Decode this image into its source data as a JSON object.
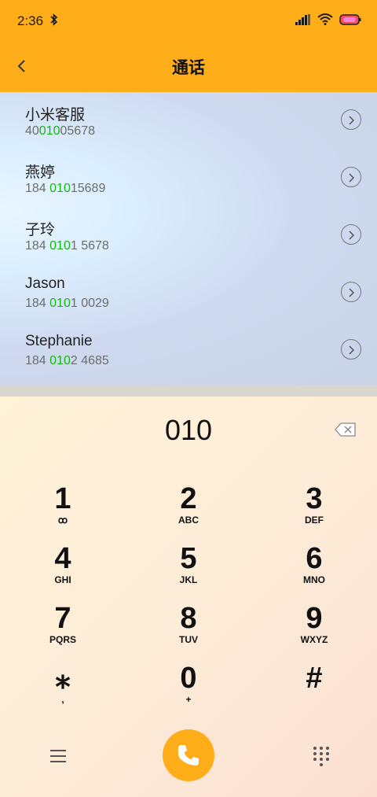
{
  "status": {
    "time": "2:36"
  },
  "header": {
    "title": "通话"
  },
  "contacts": [
    {
      "name": "小米客服",
      "num_pre": "40",
      "num_hl": "010",
      "num_post": "05678"
    },
    {
      "name": "燕婷",
      "num_pre": "184 ",
      "num_hl": "010",
      "num_post": "15689"
    },
    {
      "name": "子玲",
      "num_pre": "184 ",
      "num_hl": "010",
      "num_post": "1 5678"
    },
    {
      "name": "Jason",
      "num_pre": "184 ",
      "num_hl": "010",
      "num_post": "1 0029"
    },
    {
      "name": "Stephanie",
      "num_pre": "184 ",
      "num_hl": "010",
      "num_post": "2 4685"
    }
  ],
  "dialpad": {
    "input": "010",
    "keys": [
      {
        "digit": "1",
        "letters": "ꝏ"
      },
      {
        "digit": "2",
        "letters": "ABC"
      },
      {
        "digit": "3",
        "letters": "DEF"
      },
      {
        "digit": "4",
        "letters": "GHI"
      },
      {
        "digit": "5",
        "letters": "JKL"
      },
      {
        "digit": "6",
        "letters": "MNO"
      },
      {
        "digit": "7",
        "letters": "PQRS"
      },
      {
        "digit": "8",
        "letters": "TUV"
      },
      {
        "digit": "9",
        "letters": "WXYZ"
      },
      {
        "digit": "⁎",
        "letters": ","
      },
      {
        "digit": "0",
        "letters": "+"
      },
      {
        "digit": "#",
        "letters": ""
      }
    ]
  },
  "colors": {
    "accent": "#ffae1a",
    "match": "#18b418"
  }
}
